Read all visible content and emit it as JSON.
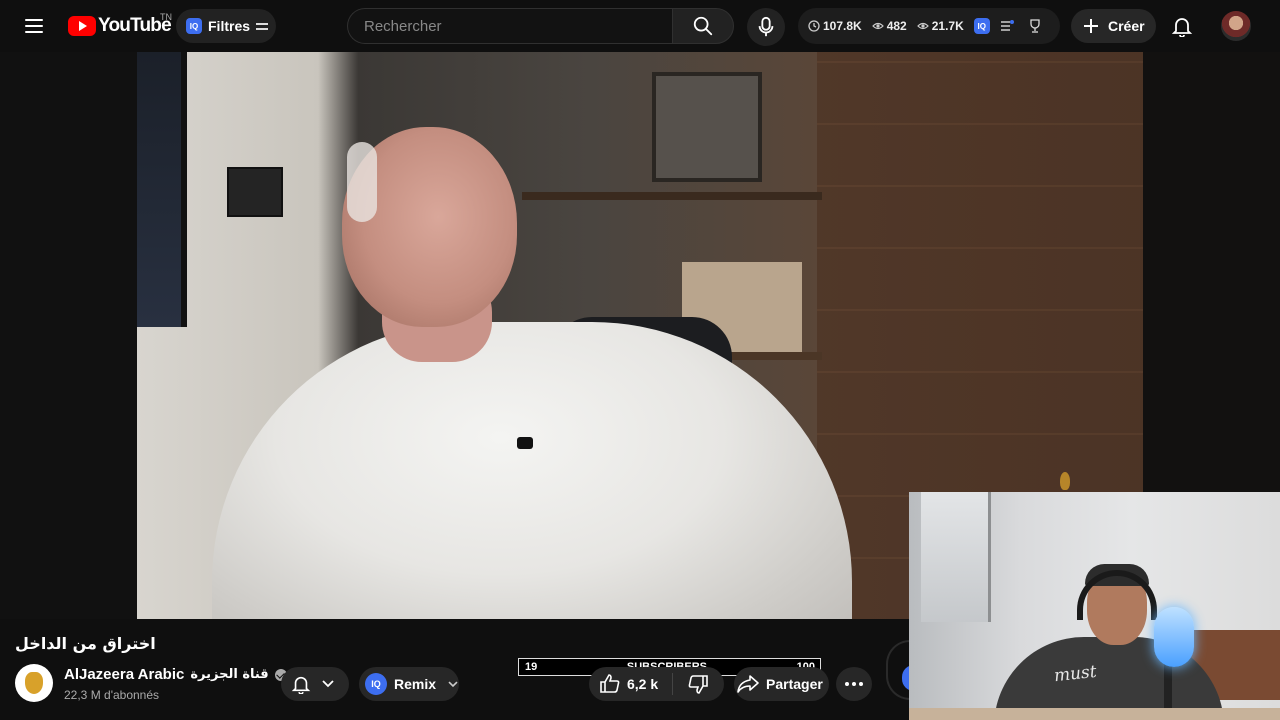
{
  "header": {
    "logo_text": "YouTube",
    "country_code": "TN",
    "filters_label": "Filtres",
    "filters_badge": "IQ",
    "search_placeholder": "Rechercher",
    "stats": [
      {
        "icon": "clock-icon",
        "value": "107.8K"
      },
      {
        "icon": "eye-icon",
        "value": "482"
      },
      {
        "icon": "eye-icon",
        "value": "21.7K"
      }
    ],
    "stats_badge": "IQ",
    "create_label": "Créer"
  },
  "video": {
    "title": "اختراق من الداخل"
  },
  "channel": {
    "name": "AlJazeera Arabic",
    "name_arabic": "قناة الجزيرة",
    "subscribers": "22,3 M d'abonnés"
  },
  "actions": {
    "remix_label": "Remix",
    "remix_badge": "IQ",
    "likes": "6,2 k",
    "share_label": "Partager"
  },
  "subscriber_goal": {
    "current": "19",
    "label": "SUBSCRIBERS",
    "target": "100"
  },
  "webcam": {
    "shirt_text": "must"
  },
  "colors": {
    "background": "#0f0f0f",
    "brand_red": "#ff0000",
    "pill": "#272727",
    "iq_blue": "#3d6ef0"
  }
}
